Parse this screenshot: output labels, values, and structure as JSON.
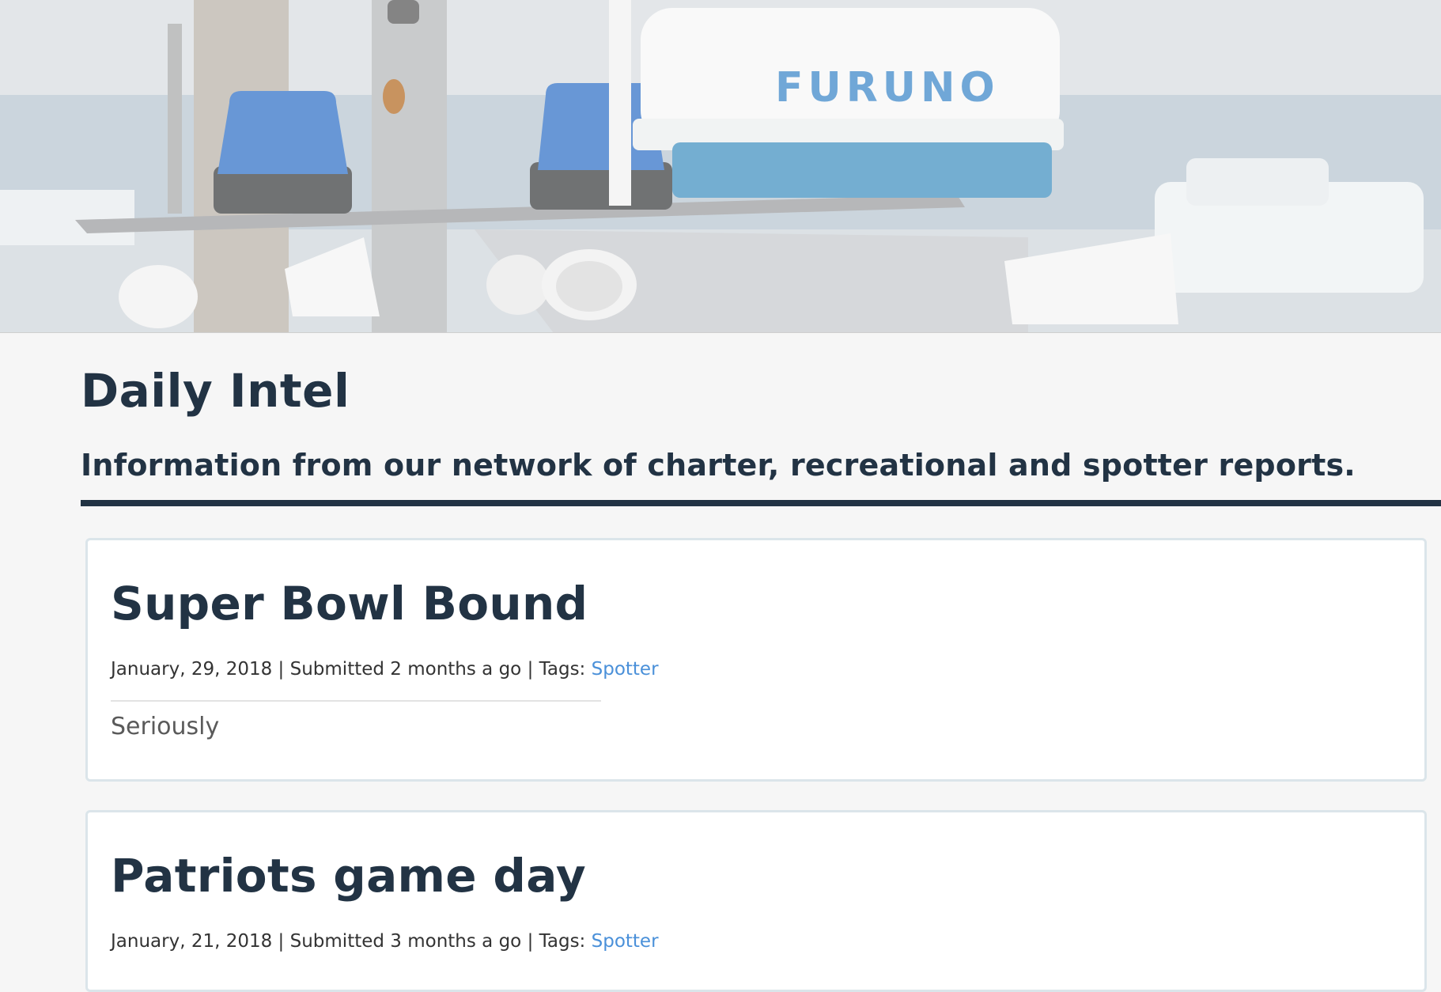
{
  "hero": {
    "image_alt": "Boat radar, blue lights and horn speakers",
    "radar_brand": "FURUNO"
  },
  "header": {
    "title": "Daily Intel",
    "subtitle": "Information from our network of charter, recreational and spotter reports."
  },
  "posts": [
    {
      "title": "Super Bowl Bound",
      "date": "January, 29, 2018",
      "sep1": " | ",
      "submitted": "Submitted 2 months a go",
      "sep2": " | ",
      "tags_label": "Tags: ",
      "tag": "Spotter",
      "body": "Seriously"
    },
    {
      "title": "Patriots game day",
      "date": "January, 21, 2018",
      "sep1": " | ",
      "submitted": "Submitted 3 months a go",
      "sep2": " | ",
      "tags_label": "Tags: ",
      "tag": "Spotter"
    }
  ],
  "colors": {
    "heading": "#223344",
    "link": "#4a90d9",
    "card_border": "#dbe5ea",
    "page_bg": "#f6f6f6"
  }
}
